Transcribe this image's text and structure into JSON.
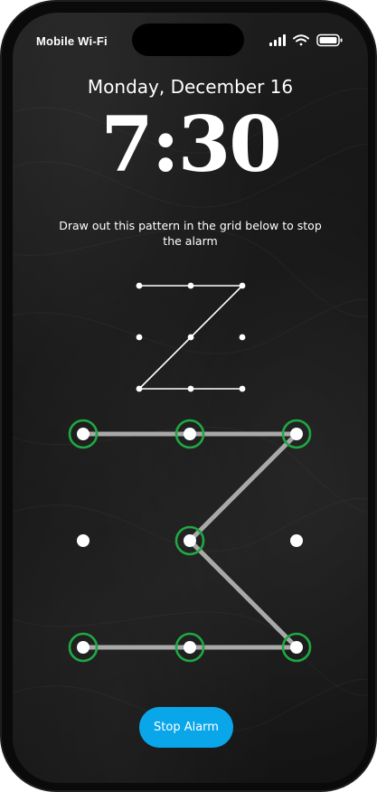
{
  "status_bar": {
    "carrier": "Mobile Wi-Fi",
    "icons": [
      "cellular-signal-icon",
      "wifi-icon",
      "battery-icon"
    ]
  },
  "lock_screen": {
    "date": "Monday, December 16",
    "time": "7:30"
  },
  "alarm": {
    "instructions": "Draw out this pattern in the grid below to stop the alarm",
    "stop_button_label": "Stop Alarm"
  },
  "pattern": {
    "grid_size": 3,
    "target_sequence": [
      0,
      1,
      2,
      4,
      6,
      7,
      8
    ],
    "drawn_sequence": [
      0,
      1,
      2,
      4,
      8,
      7,
      6
    ],
    "selected_dots": [
      0,
      1,
      2,
      4,
      6,
      7,
      8
    ]
  },
  "colors": {
    "selected_ring": "#1fa843",
    "drawn_line": "#a9a9a9",
    "preview_line": "#ffffff",
    "button_background": "#0aa6ea",
    "text": "#ffffff"
  }
}
